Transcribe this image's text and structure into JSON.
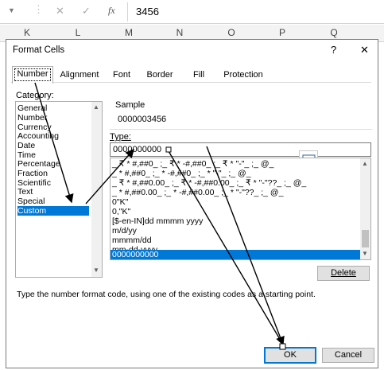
{
  "excel": {
    "formula_value": "3456",
    "fx_symbol": "fx",
    "cancel_symbol": "✕",
    "enter_symbol": "✓",
    "columns": [
      "K",
      "L",
      "M",
      "N",
      "O",
      "P",
      "Q"
    ]
  },
  "dialog": {
    "title": "Format Cells",
    "help_symbol": "?",
    "close_symbol": "✕",
    "tabs": [
      {
        "label": "Number",
        "selected": true
      },
      {
        "label": "Alignment",
        "selected": false
      },
      {
        "label": "Font",
        "selected": false
      },
      {
        "label": "Border",
        "selected": false
      },
      {
        "label": "Fill",
        "selected": false
      },
      {
        "label": "Protection",
        "selected": false
      }
    ],
    "category_label": "Category:",
    "categories": [
      "General",
      "Number",
      "Currency",
      "Accounting",
      "Date",
      "Time",
      "Percentage",
      "Fraction",
      "Scientific",
      "Text",
      "Special",
      "Custom"
    ],
    "selected_category": "Custom",
    "sample_label": "Sample",
    "sample_value": "0000003456",
    "type_label": "Type:",
    "type_value": "0000000000",
    "formats": [
      "_ ₹ * #,##0_ ;_ ₹ * -#,##0_ ;_ ₹ * \"-\"_ ;_ @_",
      "_ * #,##0_ ;_ * -#,##0_ ;_ * \"-\"_ ;_ @_",
      "_ ₹ * #,##0.00_ ;_ ₹ * -#,##0.00_ ;_ ₹ * \"-\"??_ ;_ @_",
      "_ * #,##0.00_ ;_ * -#,##0.00_ ;_ * \"-\"??_ ;_ @_",
      "0\"K\"",
      "0,\"K\"",
      "[$-en-IN]dd mmmm yyyy",
      "m/d/yy",
      "mmmm/dd",
      "mm-dd-yyyy",
      "0000000000"
    ],
    "selected_format": "0000000000",
    "delete_label": "Delete",
    "description": "Type the number format code, using one of the existing codes as a starting point.",
    "ok_label": "OK",
    "cancel_label": "Cancel",
    "accent_color": "#0078d7",
    "annotation_color": "#000000"
  }
}
